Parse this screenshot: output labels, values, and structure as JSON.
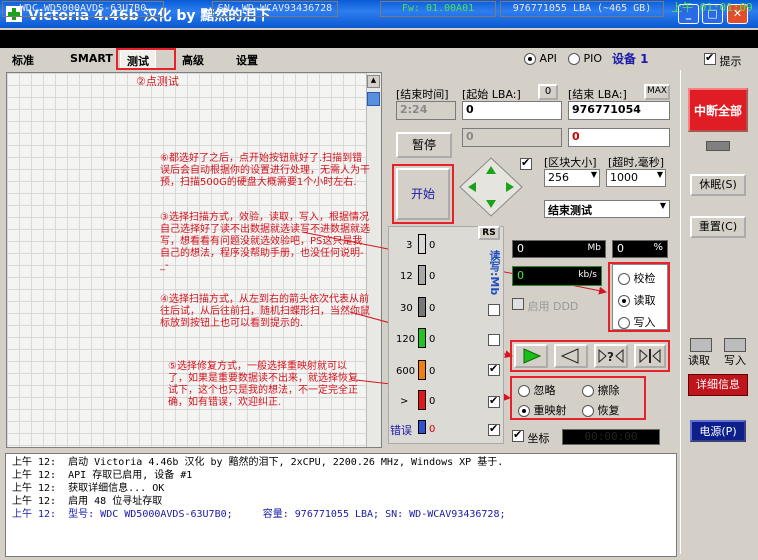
{
  "window": {
    "title": "Victoria 4.46b 汉化 by 黯然的泪下",
    "min": "_",
    "max": "□",
    "close": "✕"
  },
  "infobar": {
    "model": "WDC WD5000AVDS-63U7B0",
    "sn": "SN: WD-WCAV93436728",
    "fw": "Fw: 01.00A01",
    "lba": "976771055 LBA (~465 GB)",
    "time": "上午 01:01:09"
  },
  "tabs": [
    "标准",
    "SMART",
    "测试",
    "高级",
    "设置"
  ],
  "top_options": {
    "api": "API",
    "pio": "PIO",
    "device": "设备 1",
    "hint": "提示"
  },
  "annotations": {
    "a2": "②点测试",
    "a6": "⑥都选好了之后，点开始按钮就好了.扫描到错误后会自动根据你的设置进行处理，无需人为干预，扫描500G的硬盘大概需要1个小时左右.",
    "a3": "③选择扫描方式，效验，读取，写入，根据情况自己选择好了读不出数据就选读写不进数据就选写，想看看有问题没就选效验吧，PS这只是我自己的想法，程序没帮助手册，也没任何说明-_-",
    "a4": "④选择扫描方式，从左到右的箭头依次代表从前往后试，从后往前扫，随机扫蝶形扫，当然你鼠标放到按钮上也可以看到提示的.",
    "a5": "⑤选择修复方式，一般选择重映射就可以了，如果是重要数据读不出来，就选择恢复试下，这个也只是我的想法，不一定完全正确，如有错误，欢迎纠正."
  },
  "range": {
    "end_time_label": "[结束时间]",
    "time_value": "2:24",
    "start_lba_label": "[起始 LBA:]",
    "start_zero": "0",
    "end_lba_label": "[结束 LBA:]",
    "max": "MAX",
    "start_value": "0",
    "end_value": "976771054",
    "start_value2": "0",
    "end_value2": "0"
  },
  "controls": {
    "pause": "暂停",
    "start": "开始",
    "block_size_label": "[区块大小]",
    "timeout_label": "[超时,毫秒]",
    "block_size": "256",
    "timeout": "1000",
    "end_action": "结束测试"
  },
  "blocks": [
    {
      "label": "3",
      "count": "0",
      "color": "#d8d8d8"
    },
    {
      "label": "12",
      "count": "0",
      "color": "#a8a8a8"
    },
    {
      "label": "30",
      "count": "0",
      "color": "#787878"
    },
    {
      "label": "120",
      "count": "0",
      "color": "#22c422"
    },
    {
      "label": "600",
      "count": "0",
      "color": "#f07f10"
    },
    {
      "label": ">",
      "count": "0",
      "color": "#e01818"
    }
  ],
  "errors": {
    "label": "错误",
    "count": "0"
  },
  "rs": "RS",
  "stats": {
    "mb_value": "0",
    "mb_unit": "Mb",
    "pct_value": "0",
    "pct_unit": "%",
    "speed_value": "0",
    "speed_unit": "kb/s",
    "ddd": "启用 DDD"
  },
  "scan_mode": {
    "verify": "校检",
    "read": "读取",
    "write": "写入"
  },
  "repair": {
    "ignore": "忽略",
    "erase": "擦除",
    "remap": "重映射",
    "restore": "恢复"
  },
  "coords": {
    "label": "坐标",
    "value": "00:00:00"
  },
  "right_buttons": {
    "stop_all": "中断全部",
    "sleep": "休眠(S)",
    "reset": "重置(C)",
    "read": "读取",
    "write": "写入",
    "details": "详细信息",
    "power": "电源(P)"
  },
  "log": [
    {
      "time": "上午 12:",
      "text": "启动 Victoria 4.46b 汉化 by 黯然的泪下, 2xCPU, 2200.26 MHz, Windows XP 基于."
    },
    {
      "time": "上午 12:",
      "text": "API 存取已启用, 设备 #1"
    },
    {
      "time": "上午 12:",
      "text": "获取详细信息... OK"
    },
    {
      "time": "上午 12:",
      "text": "启用 48 位寻址存取"
    },
    {
      "time": "上午 12:",
      "text": "型号: WDC WD5000AVDS-63U7B0;     容量: 976771055 LBA; SN: WD-WCAV93436728;"
    }
  ],
  "colors": {
    "title_bar": "#0a5bd6",
    "annotation": "#d4141e",
    "stop_button": "#e01c24",
    "details_button": "#c0141c",
    "power_button": "#0c1f8a"
  }
}
